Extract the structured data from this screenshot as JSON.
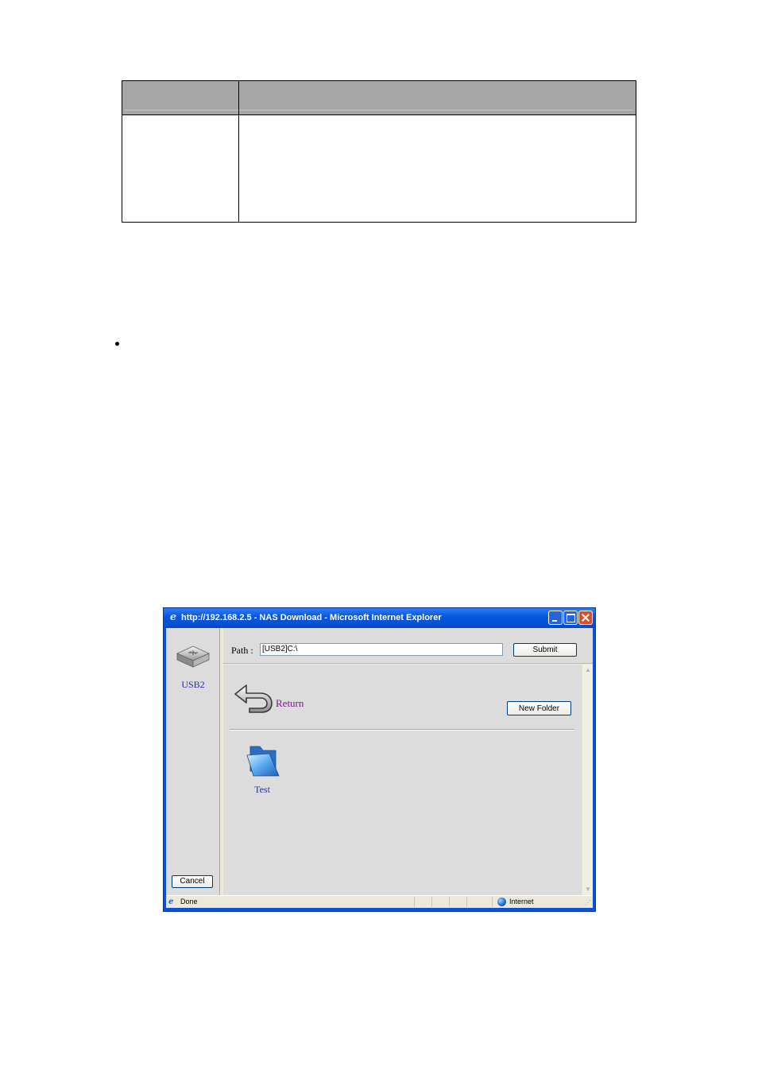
{
  "window": {
    "title": "http://192.168.2.5 - NAS Download - Microsoft Internet Explorer",
    "title_icon": "ie-icon",
    "buttons": [
      "minimize-icon",
      "maximize-icon",
      "close-icon"
    ]
  },
  "left_pane": {
    "device_icon": "usb-drive-icon",
    "device_label": "USB2",
    "cancel_label": "Cancel"
  },
  "path_bar": {
    "label": "Path :",
    "value": "[USB2]C:\\",
    "submit_label": "Submit"
  },
  "content": {
    "return_icon": "return-arrow-icon",
    "return_label": "Return",
    "new_folder_label": "New Folder",
    "items": [
      {
        "icon": "folder-icon",
        "label": "Test"
      }
    ]
  },
  "statusbar": {
    "status": "Done",
    "zone": "Internet"
  }
}
